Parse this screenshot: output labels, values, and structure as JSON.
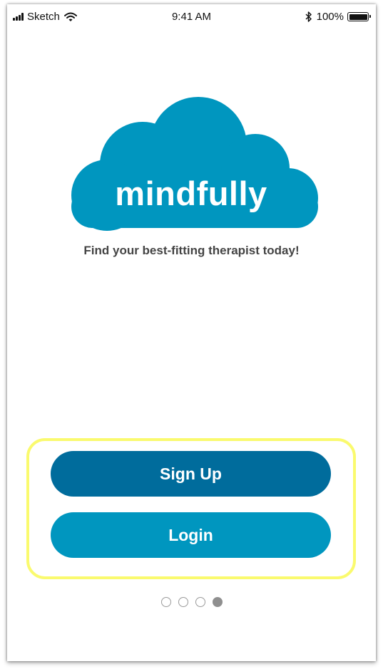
{
  "status_bar": {
    "carrier": "Sketch",
    "time": "9:41 AM",
    "battery_percent": "100%",
    "battery_level": 1.0
  },
  "logo": {
    "text": "mindfully",
    "color": "#0096bf",
    "icon": "cloud-logo-icon"
  },
  "tagline": "Find your best-fitting therapist today!",
  "buttons": {
    "signup_label": "Sign Up",
    "login_label": "Login"
  },
  "colors": {
    "signup": "#006c9c",
    "login": "#0096bf",
    "highlight": "#fafa6e"
  },
  "pager": {
    "count": 4,
    "active_index": 3
  }
}
